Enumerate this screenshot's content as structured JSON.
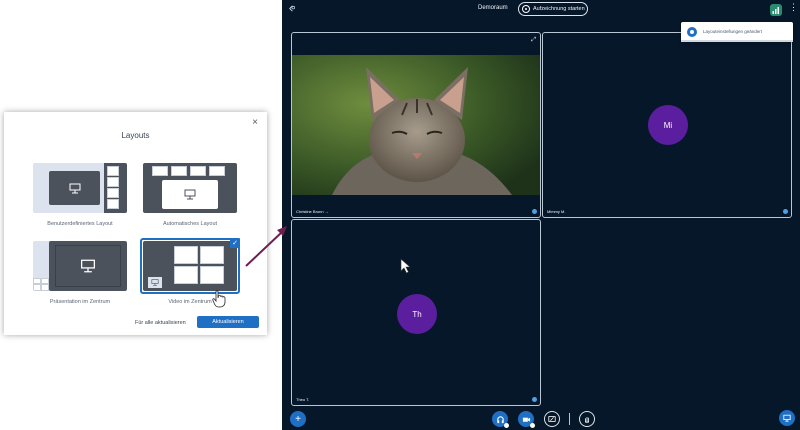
{
  "meeting": {
    "room_name": "Demoraum",
    "record_button": "Aufzeichnung starten",
    "toast": "Layouteinstellungen geändert",
    "tiles": [
      {
        "name": "Christine Brunn →"
      },
      {
        "name": "Mimmy M.",
        "initials": "Mi"
      },
      {
        "name": "Theo T.",
        "initials": "Th"
      }
    ]
  },
  "modal": {
    "title": "Layouts",
    "options": [
      {
        "label": "Benutzerdefiniertes Layout"
      },
      {
        "label": "Automatisches Layout"
      },
      {
        "label": "Präsentation im Zentrum"
      },
      {
        "label": "Video im Zentrum",
        "selected": true
      }
    ],
    "update_all_label": "Für alle aktualisieren",
    "update_label": "Aktualisieren"
  },
  "colors": {
    "accent": "#1f6fc5",
    "background": "#06172a",
    "avatar": "#5b1e9e"
  }
}
